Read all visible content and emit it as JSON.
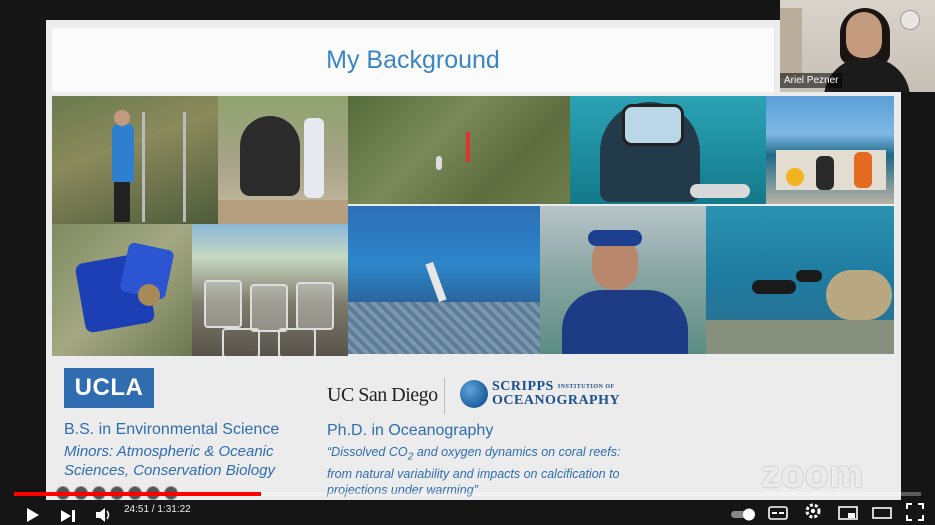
{
  "slide": {
    "title": "My Background",
    "ucla_logo": "UCLA",
    "bs_degree": "B.S. in Environmental Science",
    "bs_minors": "Minors: Atmospheric & Oceanic Sciences, Conservation Biology",
    "ucsd_logo": "UC San Diego",
    "scripps_logo_line1": "SCRIPPS",
    "scripps_logo_inst": "INSTITUTION OF",
    "scripps_logo_line2": "OCEANOGRAPHY",
    "phd_degree": "Ph.D. in Oceanography",
    "phd_quote_pre": "“Dissolved CO",
    "phd_quote_sub": "2",
    "phd_quote_post": " and oxygen dynamics on coral reefs: from natural variability and impacts on calcification to projections under warming”",
    "watermark": "zoom",
    "photos": [
      {
        "subject": "researcher-on-ladder"
      },
      {
        "subject": "bear-statue"
      },
      {
        "subject": "seagrass-overhead"
      },
      {
        "subject": "diver-selfie"
      },
      {
        "subject": "boat-team"
      },
      {
        "subject": "blue-coral-structure"
      },
      {
        "subject": "experiment-containers"
      },
      {
        "subject": "freediver-reef"
      },
      {
        "subject": "snorkeler-portrait"
      },
      {
        "subject": "divers-on-reef"
      }
    ]
  },
  "webcam": {
    "name": "Ariel Pezner"
  },
  "player": {
    "time_display": "24:51 / 1:31:22",
    "progress_fraction": 0.272,
    "accent_color": "#ff0000"
  }
}
